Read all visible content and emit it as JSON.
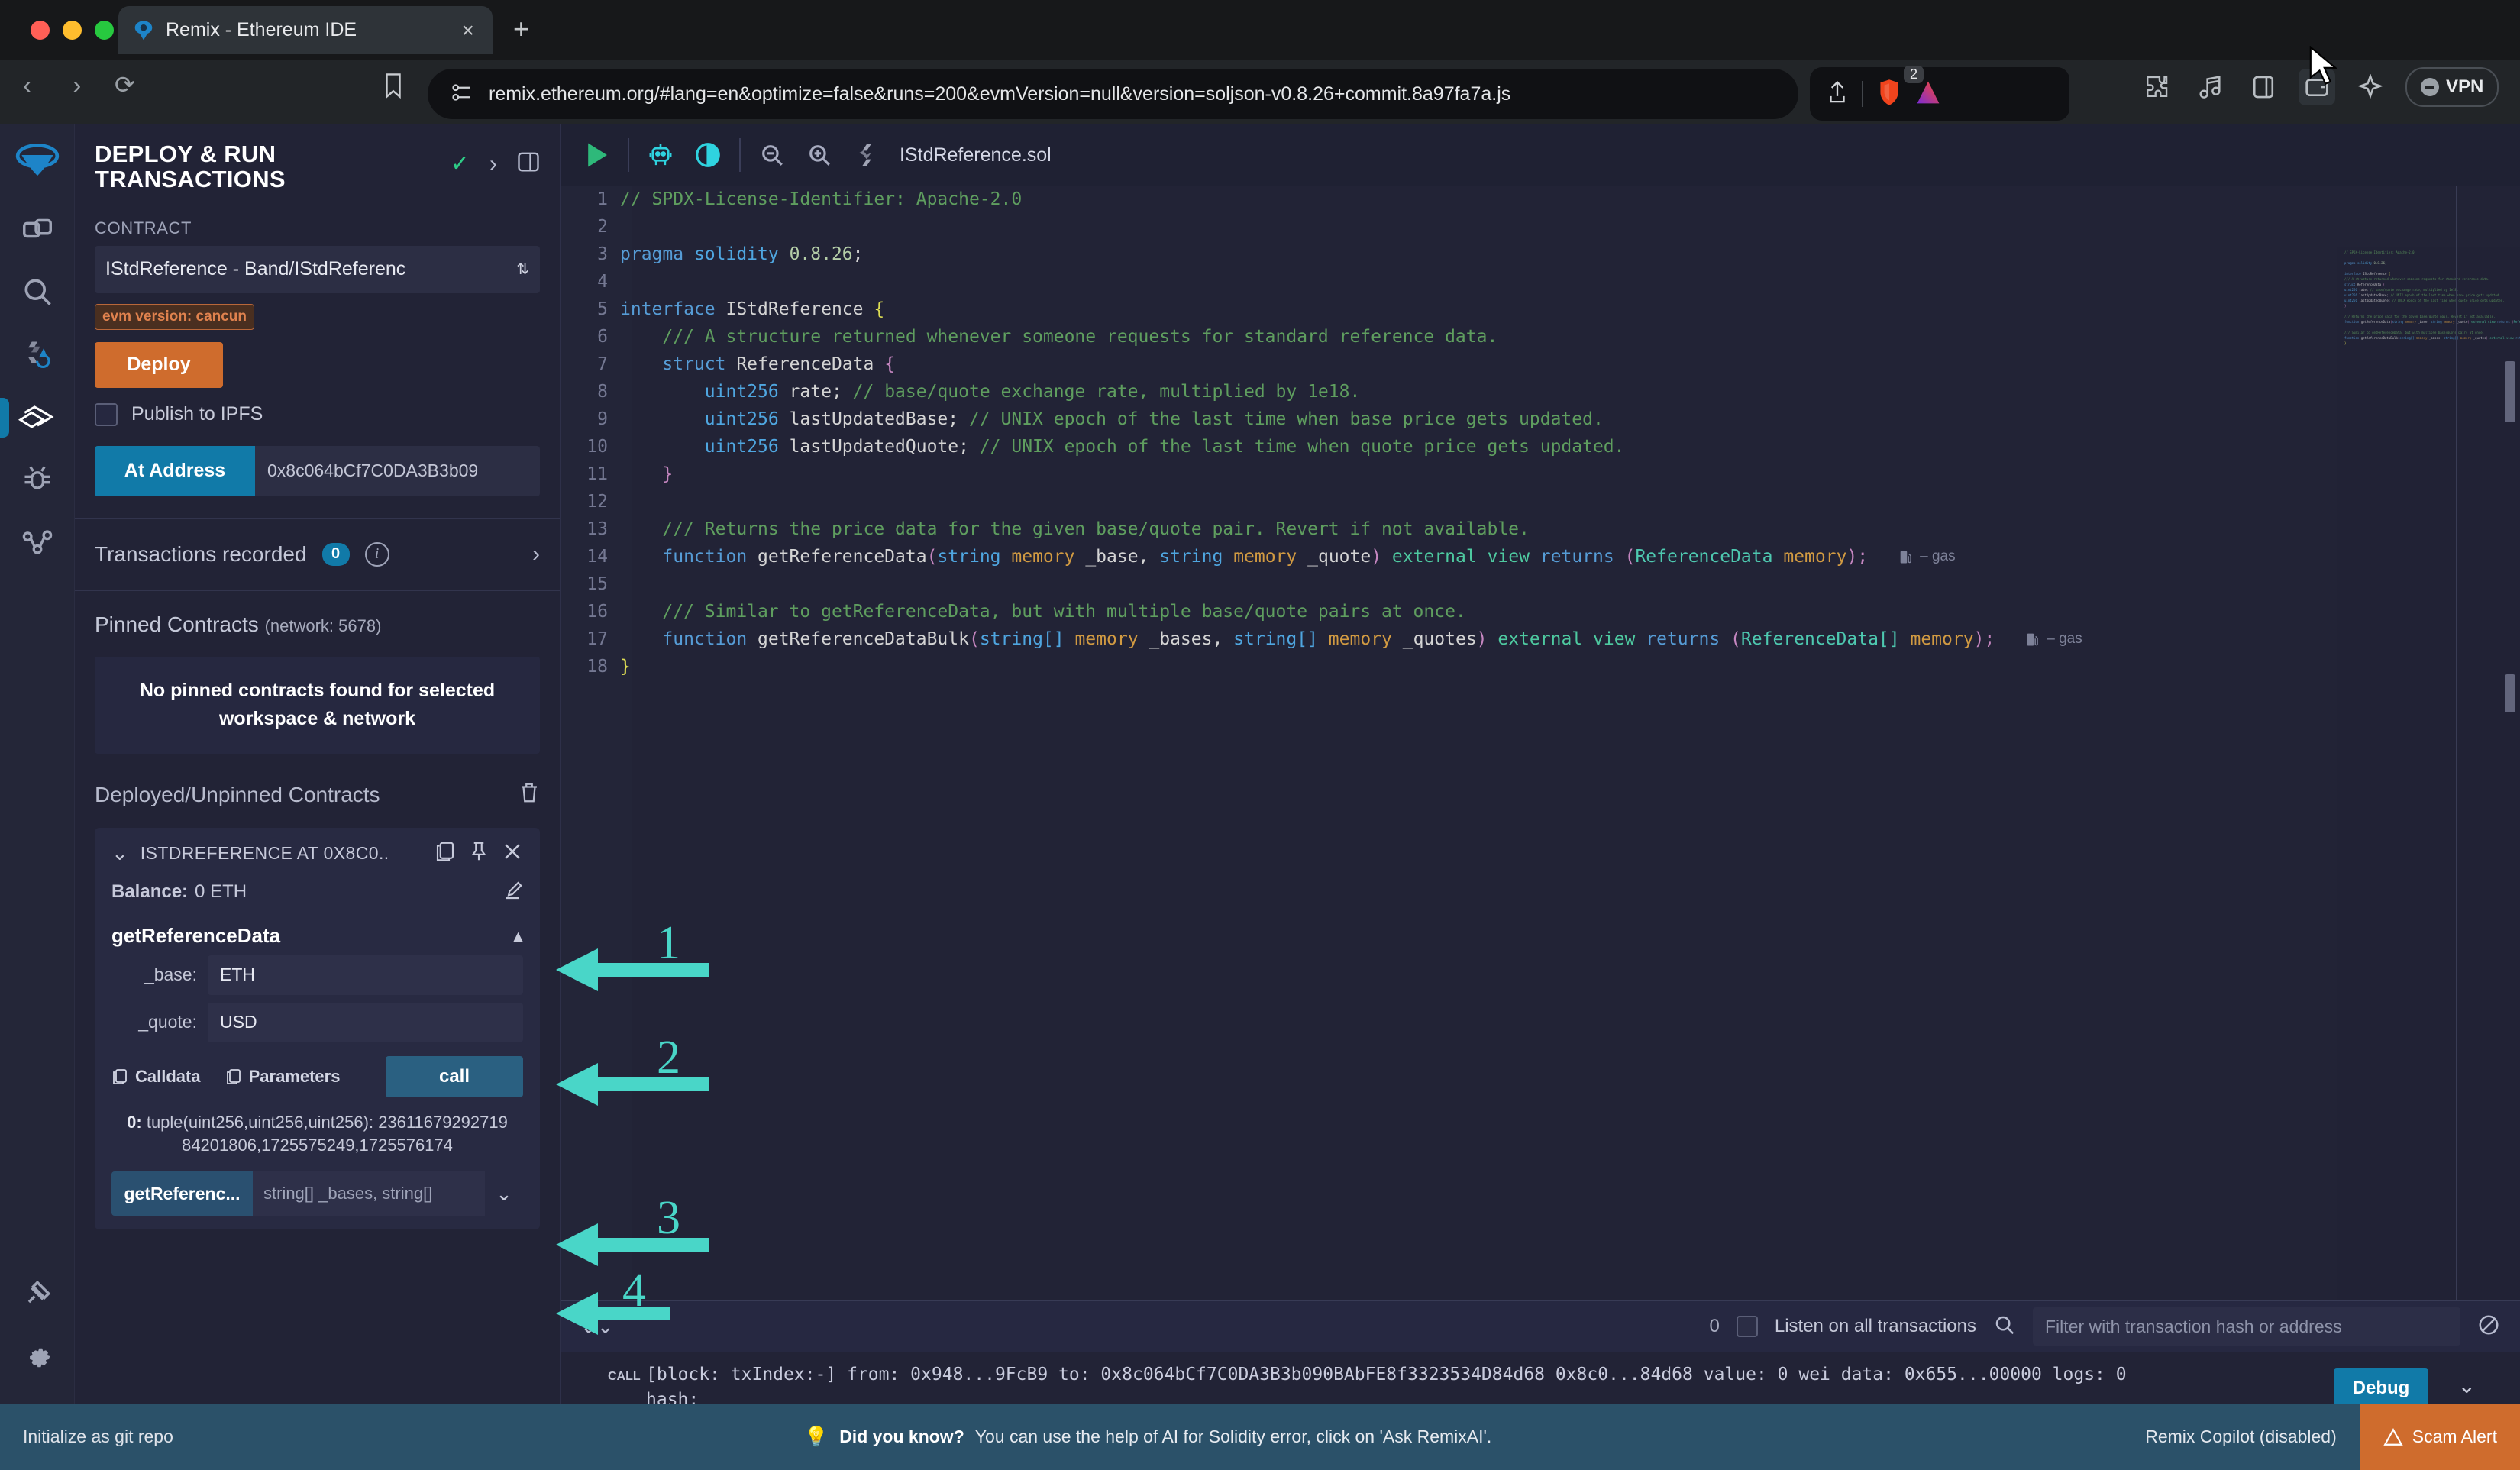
{
  "browser": {
    "tab_title": "Remix - Ethereum IDE",
    "tab_close": "×",
    "new_tab": "+",
    "url": "remix.ethereum.org/#lang=en&optimize=false&runs=200&evmVersion=null&version=soljson-v0.8.26+commit.8a97fa7a.js",
    "shield_count": "2",
    "vpn_label": "VPN"
  },
  "sidepanel": {
    "title": "DEPLOY & RUN TRANSACTIONS",
    "contract_label": "CONTRACT",
    "contract_value": "IStdReference - Band/IStdReferenc",
    "evm_badge": "evm version: cancun",
    "deploy_label": "Deploy",
    "publish_ipfs_label": "Publish to IPFS",
    "at_address_label": "At Address",
    "at_address_value": "0x8c064bCf7C0DA3B3b09",
    "transactions_recorded_label": "Transactions recorded",
    "transactions_recorded_count": "0",
    "pinned_title": "Pinned Contracts",
    "pinned_network": "(network: 5678)",
    "pinned_empty": "No pinned contracts found for selected workspace & network",
    "deployed_title": "Deployed/Unpinned Contracts",
    "instance": {
      "name": "ISTDREFERENCE AT 0X8C0..",
      "balance_label": "Balance:",
      "balance_value": "0 ETH",
      "function_name": "getReferenceData",
      "args": [
        {
          "label": "_base:",
          "value": "ETH"
        },
        {
          "label": "_quote:",
          "value": "USD"
        }
      ],
      "calldata_label": "Calldata",
      "parameters_label": "Parameters",
      "call_label": "call",
      "result_index": "0:",
      "result_type": "tuple(uint256,uint256,uint256):",
      "result_value": "2361167929271984201806,1725575249,1725576174",
      "bulk_button": "getReferenc...",
      "bulk_placeholder": "string[] _bases, string[]"
    }
  },
  "editor": {
    "filename": "IStdReference.sol",
    "gas_label": "– gas",
    "lines": [
      {
        "n": "1",
        "tokens": [
          {
            "t": "// SPDX-License-Identifier: Apache-2.0",
            "c": "c-com"
          }
        ]
      },
      {
        "n": "2",
        "tokens": []
      },
      {
        "n": "3",
        "tokens": [
          {
            "t": "pragma ",
            "c": "c-key"
          },
          {
            "t": "solidity ",
            "c": "c-blue2"
          },
          {
            "t": "0.8.26",
            "c": "c-num"
          },
          {
            "t": ";",
            "c": "c-punc"
          }
        ]
      },
      {
        "n": "4",
        "tokens": []
      },
      {
        "n": "5",
        "tokens": [
          {
            "t": "interface ",
            "c": "c-key"
          },
          {
            "t": "IStdReference ",
            "c": "c-id"
          },
          {
            "t": "{",
            "c": "c-yel"
          }
        ]
      },
      {
        "n": "6",
        "tokens": [
          {
            "t": "    /// A structure returned whenever someone requests for standard reference data.",
            "c": "c-com"
          }
        ]
      },
      {
        "n": "7",
        "tokens": [
          {
            "t": "    struct ",
            "c": "c-key"
          },
          {
            "t": "ReferenceData ",
            "c": "c-id"
          },
          {
            "t": "{",
            "c": "c-mag"
          }
        ]
      },
      {
        "n": "8",
        "tokens": [
          {
            "t": "        uint256 ",
            "c": "c-blue2"
          },
          {
            "t": "rate; ",
            "c": "c-id"
          },
          {
            "t": "// base/quote exchange rate, multiplied by 1e18.",
            "c": "c-com"
          }
        ]
      },
      {
        "n": "9",
        "tokens": [
          {
            "t": "        uint256 ",
            "c": "c-blue2"
          },
          {
            "t": "lastUpdatedBase; ",
            "c": "c-id"
          },
          {
            "t": "// UNIX epoch of the last time when base price gets updated.",
            "c": "c-com"
          }
        ]
      },
      {
        "n": "10",
        "tokens": [
          {
            "t": "        uint256 ",
            "c": "c-blue2"
          },
          {
            "t": "lastUpdatedQuote; ",
            "c": "c-id"
          },
          {
            "t": "// UNIX epoch of the last time when quote price gets updated.",
            "c": "c-com"
          }
        ]
      },
      {
        "n": "11",
        "tokens": [
          {
            "t": "    }",
            "c": "c-mag"
          }
        ]
      },
      {
        "n": "12",
        "tokens": []
      },
      {
        "n": "13",
        "tokens": [
          {
            "t": "    /// Returns the price data for the given base/quote pair. Revert if not available.",
            "c": "c-com"
          }
        ]
      },
      {
        "n": "14",
        "tokens": [
          {
            "t": "    function ",
            "c": "c-key"
          },
          {
            "t": "getReferenceData",
            "c": "c-id"
          },
          {
            "t": "(",
            "c": "c-mag"
          },
          {
            "t": "string ",
            "c": "c-blue2"
          },
          {
            "t": "memory ",
            "c": "c-orange"
          },
          {
            "t": "_base, ",
            "c": "c-id"
          },
          {
            "t": "string ",
            "c": "c-blue2"
          },
          {
            "t": "memory ",
            "c": "c-orange"
          },
          {
            "t": "_quote",
            "c": "c-id"
          },
          {
            "t": ")",
            "c": "c-mag"
          },
          {
            "t": " external ",
            "c": "c-green2"
          },
          {
            "t": "view ",
            "c": "c-green2"
          },
          {
            "t": "returns ",
            "c": "c-key"
          },
          {
            "t": "(",
            "c": "c-mag"
          },
          {
            "t": "ReferenceData ",
            "c": "c-type"
          },
          {
            "t": "memory",
            "c": "c-orange"
          },
          {
            "t": ");",
            "c": "c-mag"
          }
        ],
        "gas": true
      },
      {
        "n": "15",
        "tokens": []
      },
      {
        "n": "16",
        "tokens": [
          {
            "t": "    /// Similar to getReferenceData, but with multiple base/quote pairs at once.",
            "c": "c-com"
          }
        ]
      },
      {
        "n": "17",
        "tokens": [
          {
            "t": "    function ",
            "c": "c-key"
          },
          {
            "t": "getReferenceDataBulk",
            "c": "c-id"
          },
          {
            "t": "(",
            "c": "c-mag"
          },
          {
            "t": "string[] ",
            "c": "c-blue2"
          },
          {
            "t": "memory ",
            "c": "c-orange"
          },
          {
            "t": "_bases, ",
            "c": "c-id"
          },
          {
            "t": "string[] ",
            "c": "c-blue2"
          },
          {
            "t": "memory ",
            "c": "c-orange"
          },
          {
            "t": "_quotes",
            "c": "c-id"
          },
          {
            "t": ")",
            "c": "c-mag"
          },
          {
            "t": " external ",
            "c": "c-green2"
          },
          {
            "t": "view ",
            "c": "c-green2"
          },
          {
            "t": "returns ",
            "c": "c-key"
          },
          {
            "t": "(",
            "c": "c-mag"
          },
          {
            "t": "ReferenceData[] ",
            "c": "c-type"
          },
          {
            "t": "memory",
            "c": "c-orange"
          },
          {
            "t": ");",
            "c": "c-mag"
          }
        ],
        "gas": true
      },
      {
        "n": "18",
        "tokens": [
          {
            "t": "}",
            "c": "c-yel"
          }
        ]
      }
    ]
  },
  "terminal": {
    "counter": "0",
    "listen_label": "Listen on all transactions",
    "filter_placeholder": "Filter with transaction hash or address",
    "log_tag": "CALL",
    "log_line1": "[block: txIndex:-]  from: 0x948...9FcB9 to: 0x8c064bCf7C0DA3B3b090BAbFE8f3323534D84d68 0x8c0...84d68 value: 0 wei data: 0x655...00000 logs: 0",
    "log_line2": "hash:",
    "debug_label": "Debug",
    "prompt": ">"
  },
  "statusbar": {
    "git_label": "Initialize as git repo",
    "dyk_label": "Did you know?",
    "dyk_text": "You can use the help of AI for Solidity error, click on 'Ask RemixAI'.",
    "copilot_label": "Remix Copilot (disabled)",
    "scam_label": "Scam Alert"
  },
  "annotations": {
    "a1": "1",
    "a2": "2",
    "a3": "3",
    "a4": "4"
  }
}
